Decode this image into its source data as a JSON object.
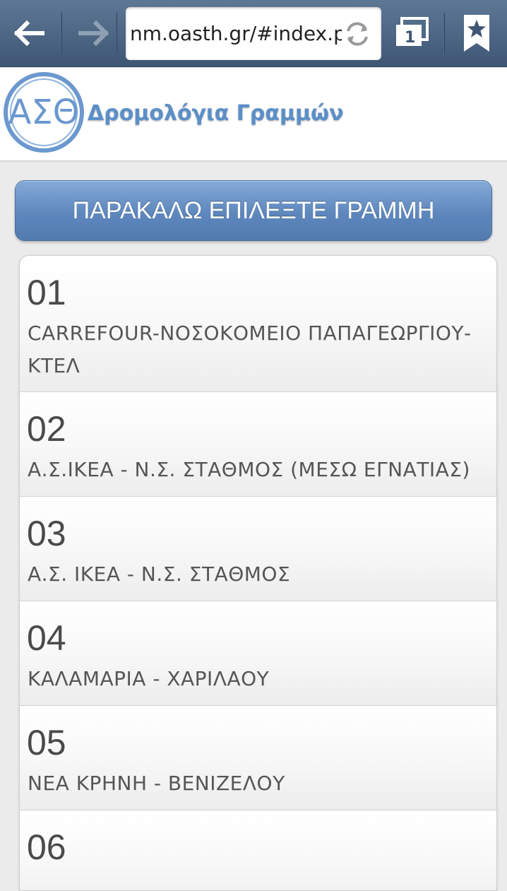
{
  "browser": {
    "url": "nm.oasth.gr/#index.php",
    "tab_count": "1",
    "icons": [
      "back-arrow-icon",
      "forward-arrow-icon",
      "refresh-icon",
      "tabs-icon",
      "bookmark-star-icon"
    ]
  },
  "header": {
    "logo_text": "ΑΣΘ",
    "title": "Δρομολόγια Γραμμών"
  },
  "main": {
    "select_heading": "ΠΑΡΑΚΑΛΩ ΕΠΙΛΕΞΤΕ ΓΡΑΜΜΗ",
    "lines": [
      {
        "number": "01",
        "route": "CARREFOUR-ΝΟΣΟΚΟΜΕΙΟ ΠΑΠΑΓΕΩΡΓΙΟΥ-ΚΤΕΛ"
      },
      {
        "number": "02",
        "route": "Α.Σ.ΙΚΕΑ - Ν.Σ. ΣΤΑΘΜΟΣ (ΜΕΣΩ ΕΓΝΑΤΙΑΣ)"
      },
      {
        "number": "03",
        "route": "Α.Σ. ΙΚΕΑ - Ν.Σ. ΣΤΑΘΜΟΣ"
      },
      {
        "number": "04",
        "route": "ΚΑΛΑΜΑΡΙΑ - ΧΑΡΙΛΑΟΥ"
      },
      {
        "number": "05",
        "route": "ΝΕΑ ΚΡΗΝΗ - ΒΕΝΙΖΕΛΟΥ"
      },
      {
        "number": "06",
        "route": ""
      }
    ]
  },
  "colors": {
    "toolbar": "#4a6482",
    "title": "#5b8fc8",
    "heading": "#6f97cb"
  }
}
